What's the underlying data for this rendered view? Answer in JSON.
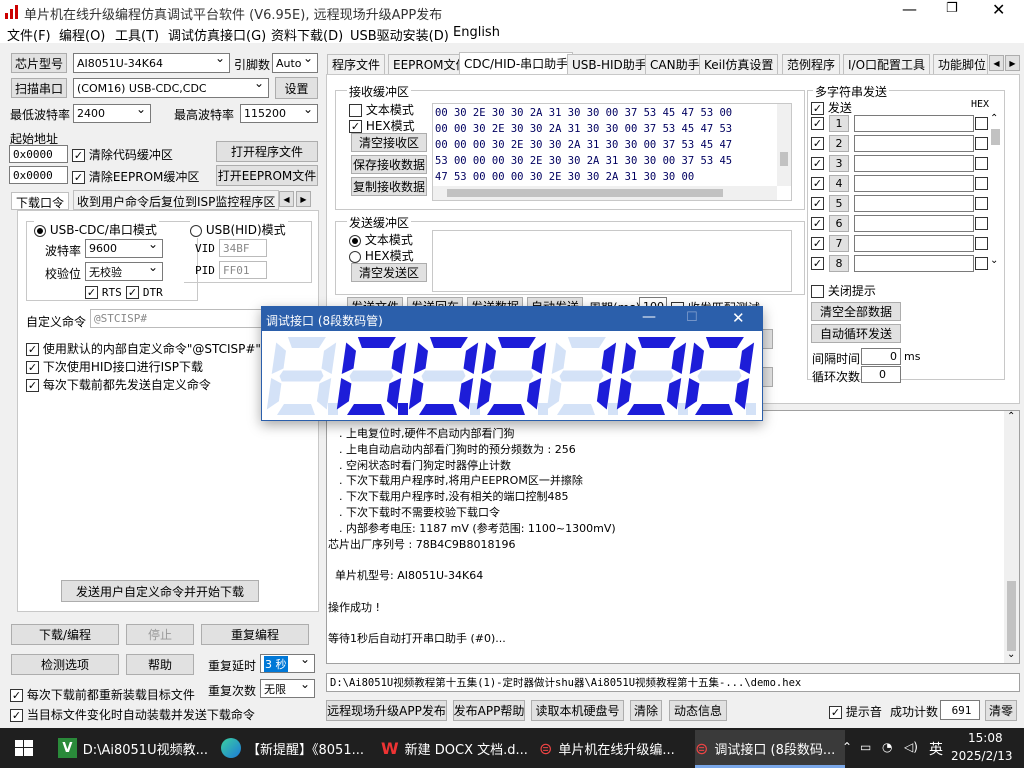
{
  "window": {
    "title": "单片机在线升级编程仿真调试平台软件 (V6.95E), 远程现场升级APP发布"
  },
  "menu": [
    "文件(F)",
    "编程(O)",
    "工具(T)",
    "调试仿真接口(G)",
    "资料下载(D)",
    "USB驱动安装(D)",
    "English"
  ],
  "left": {
    "chip_btn": "芯片型号",
    "chip_value": "AI8051U-34K64",
    "pins_label": "引脚数",
    "pins_value": "Auto",
    "scan_btn": "扫描串口",
    "port_value": "(COM16) USB-CDC,CDC",
    "settings_btn": "设置",
    "min_baud_label": "最低波特率",
    "min_baud": "2400",
    "max_baud_label": "最高波特率",
    "max_baud": "115200",
    "start_addr_label": "起始地址",
    "addr1": "0x0000",
    "clear_code": "清除代码缓冲区",
    "open_prog": "打开程序文件",
    "addr2": "0x0000",
    "clear_eeprom": "清除EEPROM缓冲区",
    "open_eeprom": "打开EEPROM文件",
    "tab1": "下载口令",
    "tab2": "收到用户命令后复位到ISP监控程序区",
    "mode_cdc": "USB-CDC/串口模式",
    "mode_hid": "USB(HID)模式",
    "baud_label": "波特率",
    "baud_value": "9600",
    "parity_label": "校验位",
    "parity_value": "无校验",
    "vid_label": "VID",
    "vid_value": "34BF",
    "pid_label": "PID",
    "pid_value": "FF01",
    "rts": "RTS",
    "dtr": "DTR",
    "custom_cmd_label": "自定义命令",
    "custom_cmd_value": "@STCISP#",
    "opt1": "使用默认的内部自定义命令\"@STCISP#\"",
    "opt2": "下次使用HID接口进行ISP下载",
    "opt3": "每次下载前都先发送自定义命令",
    "send_custom_btn": "发送用户自定义命令并开始下载",
    "download_btn": "下载/编程",
    "stop_btn": "停止",
    "reprogram_btn": "重复编程",
    "detect_btn": "检测选项",
    "help_btn": "帮助",
    "delay_label": "重复延时",
    "delay_value": "3 秒",
    "reload_opt": "每次下载前都重新装载目标文件",
    "count_label": "重复次数",
    "count_value": "无限",
    "auto_opt": "当目标文件变化时自动装载并发送下载命令"
  },
  "tabs": [
    "程序文件",
    "EEPROM文件",
    "CDC/HID-串口助手",
    "USB-HID助手",
    "CAN助手",
    "Keil仿真设置",
    "范例程序",
    "I/O口配置工具",
    "功能脚位"
  ],
  "serial": {
    "rx_title": "接收缓冲区",
    "text_mode": "文本模式",
    "hex_mode": "HEX模式",
    "clear_rx": "清空接收区",
    "save_rx": "保存接收数据",
    "copy_rx": "复制接收数据",
    "rx_lines": [
      "00 30 2E 30 30 2A 31 30 30 00 37 53 45 47 53 00",
      "00 00 30 2E 30 30 2A 31 30 30 00 37 53 45 47 53",
      "00 00 00 30 2E 30 30 2A 31 30 30 00 37 53 45 47",
      "53 00 00 00 30 2E 30 30 2A 31 30 30 00 37 53 45",
      "47 53 00 00 00 30 2E 30 30 2A 31 30 30 00"
    ],
    "tx_title": "发送缓冲区",
    "tx_text_mode": "文本模式",
    "tx_hex_mode": "HEX模式",
    "clear_tx": "清空发送区",
    "partial_buttons": [
      "发送文件",
      "发送回车",
      "发送数据",
      "自动发送"
    ],
    "period_label": "周期(ms)",
    "period_value": "100",
    "partial_check": "收发匹配测试"
  },
  "multi": {
    "title": "多字符串发送",
    "send_label": "发送",
    "hex_label": "HEX",
    "rows": [
      "1",
      "2",
      "3",
      "4",
      "5",
      "6",
      "7",
      "8"
    ],
    "close_tip": "关闭提示",
    "clear_all": "清空全部数据",
    "auto_loop": "自动循环发送",
    "interval_label": "间隔时间",
    "interval_value": "0",
    "interval_unit": "ms",
    "loop_label": "循环次数",
    "loop_value": "0"
  },
  "log": [
    ". 上电复位时,硬件不启动内部看门狗",
    ". 上电自动启动内部看门狗时的预分频数为 : 256",
    ". 空闲状态时看门狗定时器停止计数",
    ". 下次下载用户程序时,将用户EEPROM区一并擦除",
    ". 下次下载用户程序时,没有相关的端口控制485",
    ". 下次下载时不需要校验下载口令",
    ". 内部参考电压: 1187 mV (参考范围: 1100~1300mV)",
    "芯片出厂序列号 : 78B4C9B8018196",
    "",
    "  单片机型号: AI8051U-34K64",
    "",
    "操作成功 !",
    "",
    "等待1秒后自动打开串口助手 (#0)..."
  ],
  "filepath": "D:\\Ai8051U视频教程第十五集(1)-定时器做计shu器\\Ai8051U视频教程第十五集-...\\demo.hex",
  "bottom": {
    "publish": "远程现场升级APP发布",
    "publish_help": "发布APP帮助",
    "read_disk": "读取本机硬盘号",
    "clear": "清除",
    "animation": "动态信息",
    "sound": "提示音",
    "success_label": "成功计数",
    "success_value": "691",
    "reset": "清零"
  },
  "popup": {
    "title": "调试接口 (8段数码管)",
    "digits": [
      "0",
      "0",
      "0",
      "1",
      "0",
      "0"
    ]
  },
  "taskbar": {
    "items": [
      "D:\\Ai8051U视频教...",
      "【新提醒】《8051...",
      "新建 DOCX 文档.d...",
      "单片机在线升级编...",
      "调试接口 (8段数码..."
    ],
    "ime": "英",
    "time": "15:08",
    "date": "2025/2/13"
  },
  "colors": {
    "seg_on": "#1d1dd8",
    "seg_off": "#d4e2f7",
    "popup_title": "#2b5fab",
    "taskbar": "#1f1f1f"
  }
}
